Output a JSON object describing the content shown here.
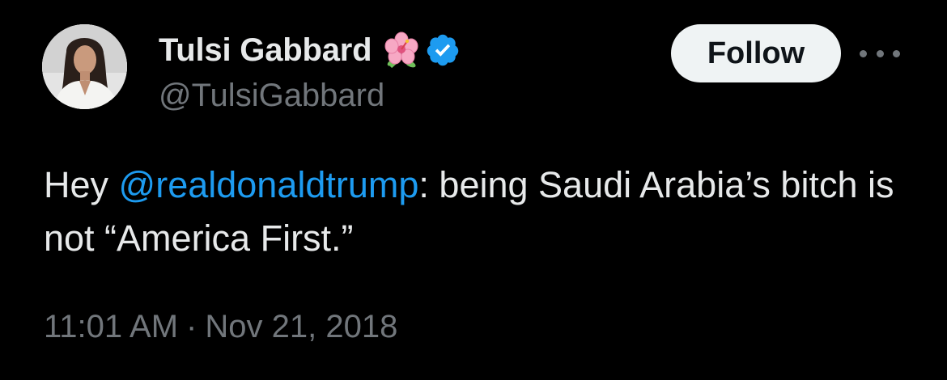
{
  "author": {
    "display_name": "Tulsi Gabbard",
    "handle": "@TulsiGabbard",
    "name_emoji": "hibiscus-icon",
    "verified": true,
    "verified_color": "#1d9bf0"
  },
  "actions": {
    "follow_label": "Follow",
    "more_icon": "more-horizontal-icon"
  },
  "tweet": {
    "text_before_mention": "Hey ",
    "mention": "@realdonaldtrump",
    "text_after_mention": ": being Saudi Arabia’s bitch is not “America First.”",
    "mention_color": "#1d9bf0"
  },
  "meta": {
    "time": "11:01 AM",
    "separator": "·",
    "date": "Nov 21, 2018"
  },
  "theme": {
    "background": "#000000",
    "primary_text": "#e7e9ea",
    "secondary_text": "#71767b"
  }
}
